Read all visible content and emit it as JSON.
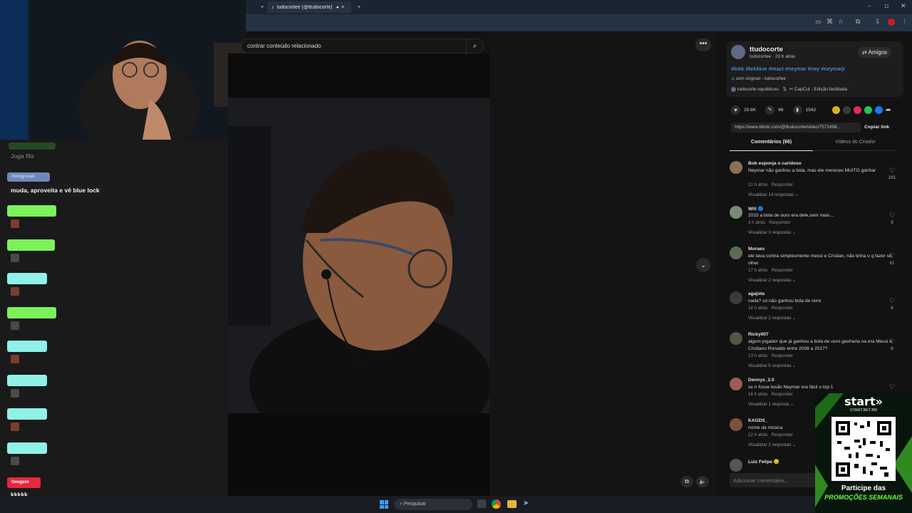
{
  "browser": {
    "tab_title": "tudocortee (@ttudocorte) |",
    "close_glyph": "×",
    "new_tab_glyph": "+"
  },
  "search": {
    "placeholder": "contrar conteúdo relacionado"
  },
  "author": {
    "name": "ttudocorte",
    "subtitle": "tudocortee · 23 h atrás",
    "friends_label": "Amigos",
    "hashtags": "#brkk #brkklive #react #neymar #ney #neymarjr",
    "sound": "som original - tudocortee",
    "reposted": "tudocorte republicou",
    "capcut": "CapCut - Edição facilitada"
  },
  "stats": {
    "likes": "29.6K",
    "comments": "66",
    "saves": "1542"
  },
  "link": {
    "url": "https://www.tiktok.com/@ttudocorte/video/7571898...",
    "copy_label": "Copiar link"
  },
  "tabs": {
    "comments": "Comentários (66)",
    "creator_videos": "Vídeos do Criador"
  },
  "comments": [
    {
      "name": "Bob esponja o caridoso",
      "text": "Neymar não ganhou a bola, mas ele mereceu MUITO ganhar",
      "meta": "21 h atrás   Responder",
      "replies": "Visualizar 14 respostas ⌄",
      "likes": "261",
      "avatar": "#8a6f58"
    },
    {
      "name": "Will 🔵",
      "text": "2015 a bola de ouro era dele,sem mais....",
      "meta": "3 h atrás   Responder",
      "replies": "Visualizar 3 respostas ⌄",
      "likes": "9",
      "avatar": "#7d8a7b"
    },
    {
      "name": "Moraes",
      "text": "ele tava contra simplesmente messi e Cristian, não tinha o q fazer só olhar",
      "meta": "17 h atrás   Responder",
      "replies": "Visualizar 2 respostas ⌄",
      "likes": "61",
      "avatar": "#5d6b55"
    },
    {
      "name": "agajota",
      "text": "nada? só não ganhou bola de ouro",
      "meta": "18 h atrás   Responder",
      "replies": "Visualizar 2 respostas ⌄",
      "likes": "8",
      "avatar": "#3a3a3a"
    },
    {
      "name": "Ricky007",
      "text": "algum jogador que já ganhou a bola de ouro ganharia na era Messi e Cristiano Ronaldo entre 2008 a 2017?",
      "meta": "13 h atrás   Responder",
      "replies": "Visualizar 5 respostas ⌄",
      "likes": "8",
      "avatar": "#4b5a3e"
    },
    {
      "name": "Dennys_2.0",
      "text": "se n fosse lesão Neymar era fácil o top 1",
      "meta": "16 h atrás   Responder",
      "replies": "Visualizar 1 resposta ⌄",
      "likes": "",
      "avatar": "#a05a5a"
    },
    {
      "name": "KAGDS_",
      "text": "nome da música",
      "meta": "22 h atrás   Responder",
      "replies": "Visualizar 2 respostas ⌄",
      "likes": "",
      "avatar": "#7a5240"
    },
    {
      "name": "Luiz Felipe 😊",
      "text": "",
      "meta": "",
      "replies": "",
      "likes": "",
      "avatar": "#555"
    }
  ],
  "add_comment_placeholder": "Adicionar comentário...",
  "chat": {
    "faded_line": "Joga fifa",
    "highlight_user": "Hiorigyuzaki",
    "highlight_text": "muda, aproveita e vê blue lock",
    "bottom_user": "Geegaxx",
    "bottom_text": "kkkkk"
  },
  "taskbar": {
    "search_label": "Pesquisar"
  },
  "ad": {
    "brand": "start»",
    "domain": "START.BET.BR",
    "cta_line1": "Participe das",
    "cta_line2": "PROMOÇÕES SEMANAIS"
  },
  "colors": {
    "accent_blue": "#5aa8ff",
    "chat_green": "#7cf25a",
    "chat_cyan": "#8ff1e8",
    "chat_red": "#e8263f",
    "ad_green": "#66ff33"
  }
}
